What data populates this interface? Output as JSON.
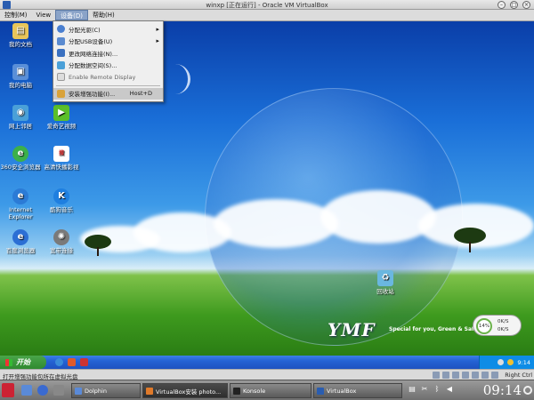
{
  "window": {
    "title": "winxp [正在运行] - Oracle VM VirtualBox",
    "controls": [
      "–",
      "□",
      "×"
    ]
  },
  "menubar": {
    "items": [
      "控制(M)",
      "View",
      "设备(D)",
      "帮助(H)"
    ],
    "active_index": 2
  },
  "dropdown": {
    "items": [
      {
        "label": "分配光驱(C)",
        "icon": "optical-drive-icon",
        "submenu": true
      },
      {
        "label": "分配USB设备(U)",
        "icon": "usb-icon",
        "submenu": true
      },
      {
        "label": "更改网络连接(N)...",
        "icon": "network-icon"
      },
      {
        "label": "分配数据空间(S)...",
        "icon": "shared-folder-icon"
      },
      {
        "label": "Enable Remote Display",
        "icon": "remote-display-icon",
        "disabled": true
      },
      {
        "label": "安装增强功能(I)...",
        "icon": "install-additions-icon",
        "shortcut": "Host+D",
        "hover": true
      }
    ]
  },
  "desktop": {
    "icons": [
      {
        "label": "我的文档",
        "color": "#e8c55a"
      },
      {
        "label": "我的电脑",
        "color": "#5a8fd8"
      },
      {
        "label": "网上邻居",
        "color": "#4aa0d8"
      },
      {
        "label": "360安全浏览器",
        "color": "#3cb04a"
      },
      {
        "label": "Internet Explorer",
        "color": "#2b7bd6"
      },
      {
        "label": "百度浏览器",
        "color": "#2c6fd4"
      },
      {
        "label": "爱奇艺视频",
        "color": "#5bbf2a"
      },
      {
        "label": "高清快播影视",
        "color": "#d33"
      },
      {
        "label": "酷狗音乐",
        "color": "#1f7fe0"
      },
      {
        "label": "宽带连接",
        "color": "#7a7a7a"
      },
      {
        "label": "回收站",
        "color": "#6ab7e0"
      }
    ],
    "logo": "YMF",
    "logo_tagline": "Special for you, Green & Safe",
    "netmon": {
      "percent": "14%",
      "up": "0K/S",
      "down": "0K/S"
    }
  },
  "xp_taskbar": {
    "start_label": "开始",
    "clock": "9:14"
  },
  "vbox_status": {
    "message": "打开增强功能包所在虚拟光盘",
    "host_key": "Right Ctrl"
  },
  "host_panel": {
    "tasks": [
      {
        "label": "Dolphin",
        "color": "#5a8ad8"
      },
      {
        "label": "VirtualBox安装 photo...",
        "color": "#e07a2a",
        "active": true
      },
      {
        "label": "Konsole",
        "color": "#333"
      },
      {
        "label": "VirtualBox",
        "color": "#2a5db0"
      }
    ],
    "clock": "09:14"
  }
}
